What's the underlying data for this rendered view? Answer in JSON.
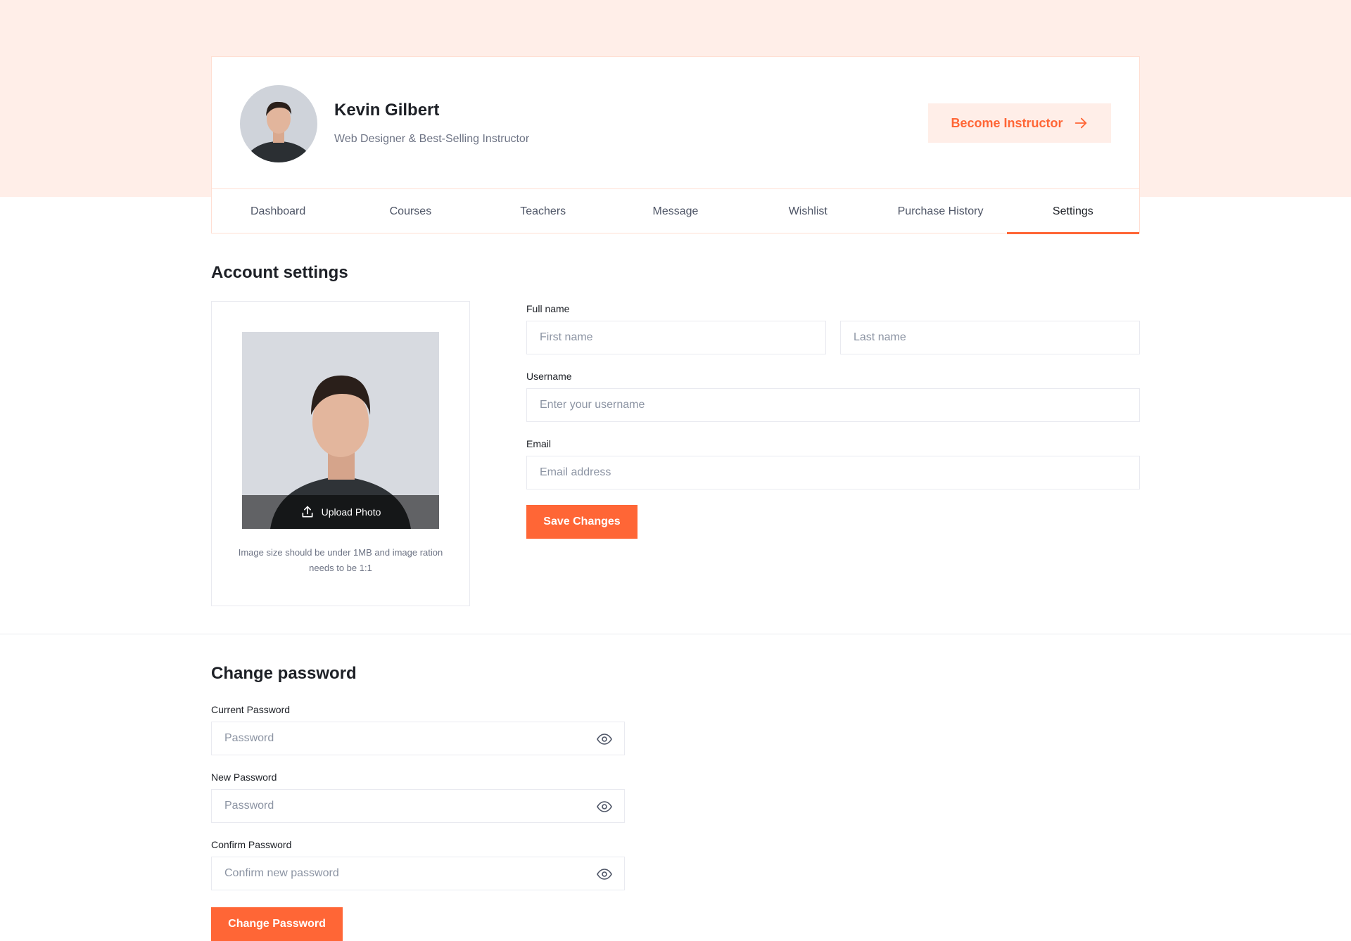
{
  "profile": {
    "name": "Kevin Gilbert",
    "role": "Web Designer & Best-Selling Instructor",
    "become_instructor_label": "Become Instructor"
  },
  "tabs": [
    {
      "label": "Dashboard"
    },
    {
      "label": "Courses"
    },
    {
      "label": "Teachers"
    },
    {
      "label": "Message"
    },
    {
      "label": "Wishlist"
    },
    {
      "label": "Purchase History"
    },
    {
      "label": "Settings",
      "active": true
    }
  ],
  "account": {
    "title": "Account settings",
    "upload_label": "Upload Photo",
    "photo_note": "Image size should be under 1MB and image ration needs to be 1:1",
    "full_name_label": "Full name",
    "first_name_placeholder": "First name",
    "last_name_placeholder": "Last name",
    "username_label": "Username",
    "username_placeholder": "Enter your username",
    "email_label": "Email",
    "email_placeholder": "Email address",
    "save_label": "Save Changes"
  },
  "password": {
    "title": "Change password",
    "current_label": "Current Password",
    "current_placeholder": "Password",
    "new_label": "New Password",
    "new_placeholder": "Password",
    "confirm_label": "Confirm Password",
    "confirm_placeholder": "Confirm new password",
    "submit_label": "Change Password"
  },
  "colors": {
    "accent": "#ff6636",
    "accent_light": "#ffeee8",
    "border": "#e9eaf0"
  },
  "icons": {
    "become_instructor": "arrow-right-icon",
    "upload": "upload-icon",
    "password_toggle": "eye-icon"
  }
}
